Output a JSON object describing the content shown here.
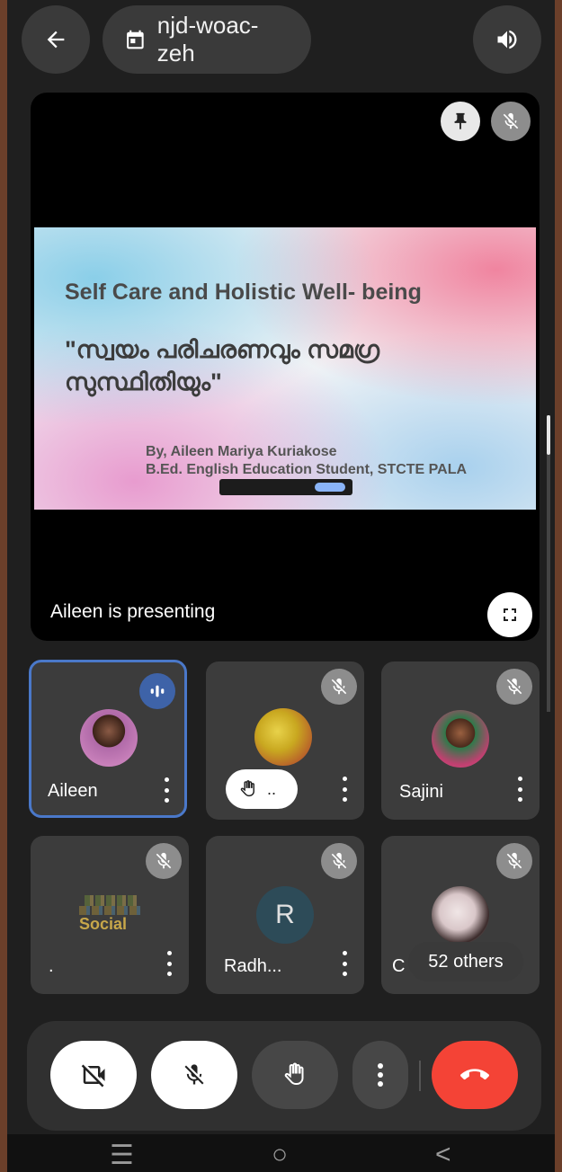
{
  "topbar": {
    "back_icon": "arrow-left-icon",
    "meeting_code": "njd-woac-zeh",
    "calendar_icon": "calendar-icon",
    "audio_icon": "speaker-icon"
  },
  "stage": {
    "presenting_label": "Aileen is presenting",
    "slide": {
      "title": "Self Care and Holistic Well- being",
      "subtitle": "\"സ്വയം പരിചരണവും സമഗ്ര സുസ്ഥിതിയും\"",
      "byline_1": "By, Aileen Mariya Kuriakose",
      "byline_2": "B.Ed. English Education Student, STCTE PALA"
    },
    "pin_icon": "pin-icon",
    "mic_off_icon": "mic-off-icon",
    "fullscreen_icon": "fullscreen-icon"
  },
  "participants": [
    {
      "name": "Aileen",
      "status": "speaking",
      "avatar": "photo"
    },
    {
      "name": "..",
      "status": "hand-raised",
      "avatar": "photo"
    },
    {
      "name": "Sajini",
      "status": "muted",
      "avatar": "photo"
    },
    {
      "name": ".",
      "status": "muted",
      "avatar": "word-cloud",
      "avatar_text": "Social"
    },
    {
      "name": "Radh...",
      "status": "muted",
      "avatar": "initial",
      "initial": "R"
    },
    {
      "name": "C",
      "status": "muted",
      "avatar": "photo",
      "overflow_label": "52 others"
    }
  ],
  "controls": {
    "camera_icon": "camera-off-icon",
    "mic_icon": "mic-off-icon",
    "hand_icon": "raise-hand-icon",
    "more_icon": "more-vert-icon",
    "end_call_icon": "call-end-icon"
  },
  "colors": {
    "end_call": "#f44336",
    "active_border": "#4a78c9",
    "speaking_badge": "#3e63a8"
  },
  "navbar": {
    "recents": "☰",
    "home": "○",
    "back": "<"
  }
}
